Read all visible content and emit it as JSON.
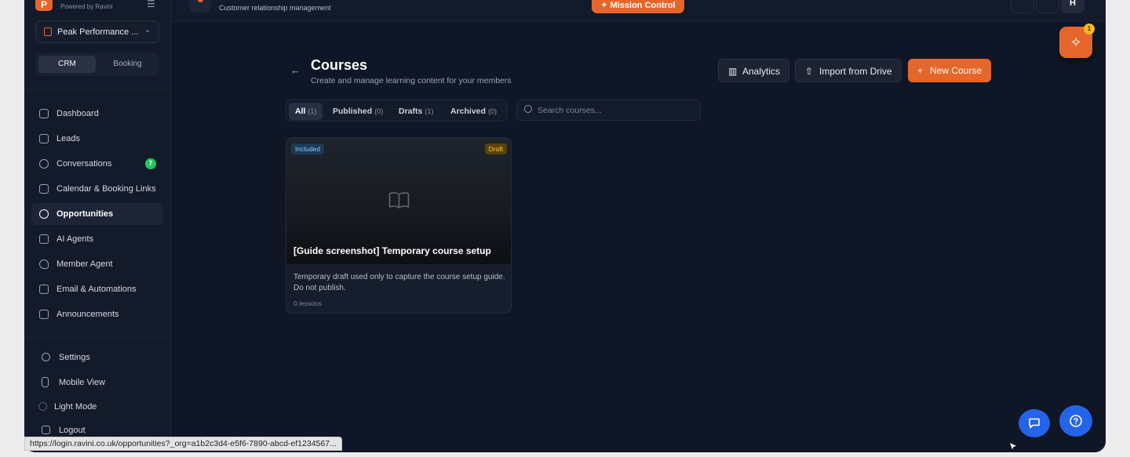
{
  "brand": {
    "logo_letter": "P",
    "powered_by": "Powered by Ravini"
  },
  "workspace": {
    "name": "Peak Performance ..."
  },
  "mode_toggle": {
    "options": [
      "CRM",
      "Booking"
    ],
    "active": "CRM"
  },
  "nav": [
    {
      "label": "Dashboard",
      "icon": "home-icon"
    },
    {
      "label": "Leads",
      "icon": "users-icon"
    },
    {
      "label": "Conversations",
      "icon": "chat-bubble-icon",
      "badge": "7"
    },
    {
      "label": "Calendar & Booking Links",
      "icon": "calendar-icon"
    },
    {
      "label": "Opportunities",
      "icon": "dollar-circle-icon",
      "active": true
    },
    {
      "label": "AI Agents",
      "icon": "monitor-icon"
    },
    {
      "label": "Member Agent",
      "icon": "heart-icon"
    },
    {
      "label": "Email & Automations",
      "icon": "mail-icon"
    },
    {
      "label": "Announcements",
      "icon": "mail-icon"
    }
  ],
  "sidebar_bottom": [
    {
      "label": "Settings",
      "icon": "gear-icon"
    },
    {
      "label": "Mobile View",
      "icon": "phone-icon"
    },
    {
      "label": "Light Mode",
      "icon": "sun-icon"
    },
    {
      "label": "Logout",
      "icon": "logout-icon"
    }
  ],
  "header": {
    "subtitle": "Customer relationship management",
    "mission_control_label": "Mission Control",
    "avatar_initial": "H"
  },
  "ai_fab": {
    "badge": "1"
  },
  "page": {
    "title": "Courses",
    "subtitle": "Create and manage learning content for your members",
    "buttons": {
      "analytics": "Analytics",
      "import": "Import from Drive",
      "new_course": "New Course"
    },
    "tabs": [
      {
        "label": "All",
        "count": "(1)",
        "active": true
      },
      {
        "label": "Published",
        "count": "(0)"
      },
      {
        "label": "Drafts",
        "count": "(1)"
      },
      {
        "label": "Archived",
        "count": "(0)"
      }
    ],
    "search_placeholder": "Search courses..."
  },
  "courses": [
    {
      "badge_left": "Included",
      "badge_right": "Draft",
      "title": "[Guide screenshot] Temporary course setup",
      "description": "Temporary draft used only to capture the course setup guide. Do not publish.",
      "lessons": "0 lessons"
    }
  ],
  "status_url": "https://login.ravini.co.uk/opportunities?_org=a1b2c3d4-e5f6-7890-abcd-ef1234567...",
  "colors": {
    "accent": "#e5662b",
    "background": "#0f1626",
    "sidebar": "#131a29",
    "success": "#22c55e",
    "chat": "#2563eb"
  }
}
